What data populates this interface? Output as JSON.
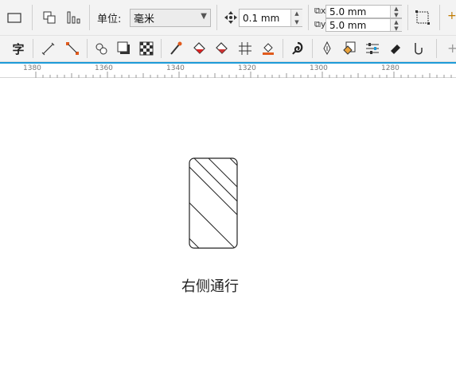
{
  "property_bar": {
    "units_label": "单位:",
    "units_value": "毫米",
    "nudge_value": "0.1 mm",
    "dup_x": "5.0 mm",
    "dup_y": "5.0 mm"
  },
  "ruler": {
    "ticks": [
      "1380",
      "1360",
      "1340",
      "1320",
      "1300",
      "1280"
    ]
  },
  "toolbox": {
    "text_tool_glyph": "字"
  },
  "drawing": {
    "caption": "右侧通行"
  }
}
